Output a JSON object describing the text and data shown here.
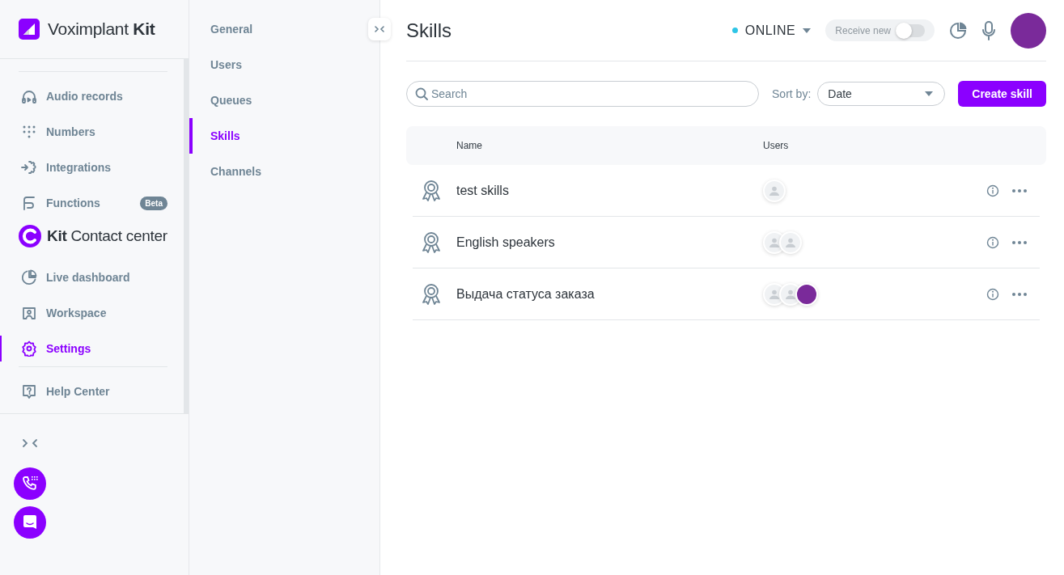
{
  "brand": {
    "name": "Voximplant **Kit**"
  },
  "nav_items": [
    {
      "label": "Audio records",
      "selected": false
    },
    {
      "label": "Numbers",
      "selected": false
    },
    {
      "label": "Integrations",
      "selected": false
    },
    {
      "label": "Functions",
      "selected": false,
      "badge": "Beta"
    }
  ],
  "section_title": "**Kit** Contact center",
  "nav_items_2": [
    {
      "label": "Live dashboard",
      "selected": false
    },
    {
      "label": "Workspace",
      "selected": false
    },
    {
      "label": "Settings",
      "selected": true
    }
  ],
  "help_item": {
    "label": "Help Center"
  },
  "sub_nav": [
    {
      "label": "General",
      "selected": false
    },
    {
      "label": "Users",
      "selected": false
    },
    {
      "label": "Queues",
      "selected": false
    },
    {
      "label": "Skills",
      "selected": true
    },
    {
      "label": "Channels",
      "selected": false
    }
  ],
  "page_title": "Skills",
  "status": {
    "label": "ONLINE"
  },
  "receive_new": {
    "label": "Receive new",
    "on": false
  },
  "search": {
    "placeholder": "Search"
  },
  "sort": {
    "label": "Sort by:",
    "value": "Date"
  },
  "create_button": "Create skill",
  "table": {
    "columns": [
      "Name",
      "Users"
    ],
    "rows": [
      {
        "name": "test skills",
        "users": [
          {
            "kind": "placeholder"
          }
        ]
      },
      {
        "name": "English speakers",
        "users": [
          {
            "kind": "placeholder"
          },
          {
            "kind": "placeholder"
          }
        ]
      },
      {
        "name": "Выдача статуса заказа",
        "users": [
          {
            "kind": "placeholder"
          },
          {
            "kind": "placeholder"
          },
          {
            "kind": "photo"
          }
        ]
      }
    ]
  }
}
